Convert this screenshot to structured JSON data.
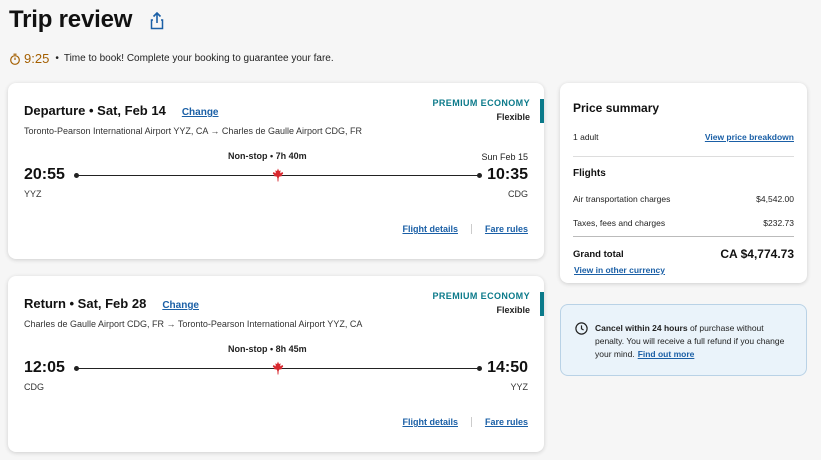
{
  "page": {
    "title": "Trip review"
  },
  "timer": {
    "value": "9:25",
    "bullet": "•",
    "message": "Time to book! Complete your booking to guarantee your fare."
  },
  "departure": {
    "title": "Departure • Sat, Feb 14",
    "change_label": "Change",
    "route": "Toronto-Pearson International Airport YYZ, CA → Charles de Gaulle Airport CDG, FR",
    "cabin": "PREMIUM ECONOMY",
    "fare_type": "Flexible",
    "stops_duration": "Non-stop • 7h 40m",
    "arrival_date": "Sun Feb 15",
    "dep_time": "20:55",
    "dep_code": "YYZ",
    "arr_time": "10:35",
    "arr_code": "CDG",
    "details_label": "Flight details",
    "fare_rules_label": "Fare rules"
  },
  "return": {
    "title": "Return • Sat, Feb 28",
    "change_label": "Change",
    "route": "Charles de Gaulle Airport CDG, FR → Toronto-Pearson International Airport YYZ, CA",
    "cabin": "PREMIUM ECONOMY",
    "fare_type": "Flexible",
    "stops_duration": "Non-stop • 8h 45m",
    "dep_time": "12:05",
    "dep_code": "CDG",
    "arr_time": "14:50",
    "arr_code": "YYZ",
    "details_label": "Flight details",
    "fare_rules_label": "Fare rules"
  },
  "price_summary": {
    "title": "Price summary",
    "passengers": "1 adult",
    "breakdown_link": "View price breakdown",
    "flights_heading": "Flights",
    "air_charges_label": "Air transportation charges",
    "air_charges_value": "$4,542.00",
    "taxes_label": "Taxes, fees and charges",
    "taxes_value": "$232.73",
    "grand_total_label": "Grand total",
    "grand_total_value": "CA $4,774.73",
    "currency_link": "View in other currency"
  },
  "cancel_notice": {
    "bold": "Cancel within 24 hours",
    "text": " of purchase without penalty. You will receive a full refund if you change your mind.",
    "link": "Find out more"
  },
  "colors": {
    "accent_teal": "#0b7a8a",
    "link_blue": "#1a5fa6",
    "timer_orange": "#a45f00",
    "maple_red": "#d8292f"
  }
}
